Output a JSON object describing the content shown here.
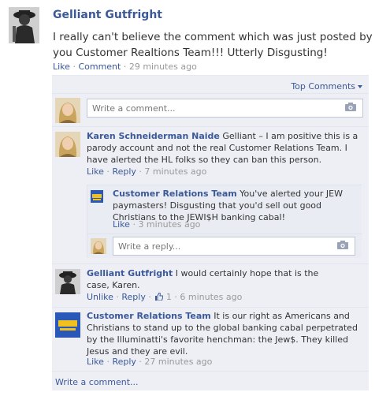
{
  "post": {
    "author": "Gelliant Gutfright",
    "text": "I really can't believe the comment which was just posted by you Customer Realtions Team!!! Utterly Disgusting!",
    "like_label": "Like",
    "comment_label": "Comment",
    "time": "29 minutes ago"
  },
  "comments_header": {
    "sort_label": "Top Comments"
  },
  "comment_box": {
    "placeholder": "Write a comment..."
  },
  "comments": [
    {
      "author": "Karen Schneiderman Naide",
      "text": "Gelliant – I am positive this is a parody account and not the real Customer Relations Team. I have alerted the HL folks so they can ban this person.",
      "like_label": "Like",
      "reply_label": "Reply",
      "time": "7 minutes ago",
      "replies": [
        {
          "author": "Customer Relations Team",
          "text": "You've alerted your JEW paymasters! Disgusting that you'd sell out good Christians to the JEWI$H banking cabal!",
          "like_label": "Like",
          "time": "3 minutes ago"
        }
      ],
      "reply_box_placeholder": "Write a reply..."
    },
    {
      "author": "Gelliant Gutfright",
      "text": "I would certainly hope that is the case, Karen.",
      "unlike_label": "Unlike",
      "reply_label": "Reply",
      "like_count": "1",
      "time": "6 minutes ago"
    },
    {
      "author": "Customer Relations Team",
      "text": "It is our right as Americans and Christians to stand up to the global banking cabal perpetrated by the Illuminatti's favorite henchman: the Jew$. They killed Jesus and they are evil.",
      "like_label": "Like",
      "reply_label": "Reply",
      "time": "27 minutes ago"
    }
  ],
  "footer": {
    "write_comment_label": "Write a comment..."
  },
  "separator": "·",
  "colors": {
    "link": "#3b5998",
    "panel_bg": "#edeff4",
    "meta": "#999999"
  }
}
